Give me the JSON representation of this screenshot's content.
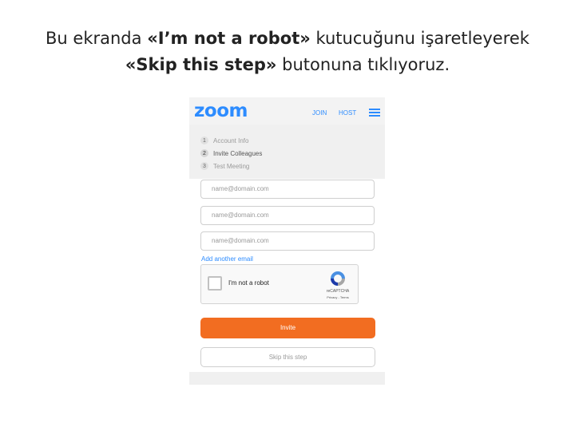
{
  "caption": {
    "line1_pre": "Bu ekranda ",
    "line1_bold": "«I’m not a robot»",
    "line1_post": " kutucuğunu işaretleyerek",
    "line2_bold": "«Skip this step»",
    "line2_post": " butonuna tıklıyoruz."
  },
  "app": {
    "logo": "zoom",
    "nav": {
      "join": "JOIN",
      "host": "HOST"
    },
    "menu_icon": "hamburger-menu-icon",
    "brand_color": "#2d8cff",
    "accent_color": "#f26d21"
  },
  "steps": [
    {
      "num": "1",
      "label": "Account Info",
      "active": false
    },
    {
      "num": "2",
      "label": "Invite Colleagues",
      "active": true
    },
    {
      "num": "3",
      "label": "Test Meeting",
      "active": false
    }
  ],
  "form": {
    "email_placeholders": [
      "name@domain.com",
      "name@domain.com",
      "name@domain.com"
    ],
    "add_link": "Add another email",
    "captcha": {
      "label": "I'm not a robot",
      "brand": "reCAPTCHA",
      "links": "Privacy - Terms",
      "icon": "recaptcha-logo-icon"
    },
    "invite_button": "Invite",
    "skip_button": "Skip this step"
  }
}
